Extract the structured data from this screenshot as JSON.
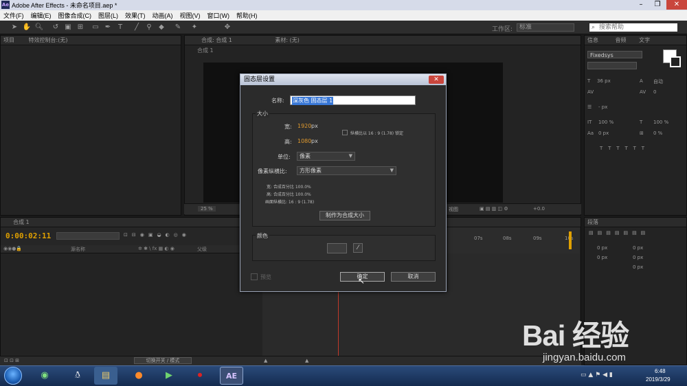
{
  "window": {
    "title": "Adobe After Effects - 未命名项目.aep *",
    "logo": "Ae"
  },
  "menu": [
    "文件(F)",
    "编辑(E)",
    "图像合成(C)",
    "图层(L)",
    "效果(T)",
    "动画(A)",
    "视图(V)",
    "窗口(W)",
    "帮助(H)"
  ],
  "toolbar": {
    "workspace_label": "工作区:",
    "workspace_value": "标准",
    "search_placeholder": "搜索帮助"
  },
  "left_panel": {
    "tab_project": "项目",
    "tab_effects": "特效控制台:(无)"
  },
  "comp_panel": {
    "tab_comp": "合成: 合成 1",
    "tab_footage": "素材: (无)",
    "comp_name": "合成 1",
    "zoom": "25 %",
    "view_label": "视图",
    "exposure": "+0.0"
  },
  "right_panel": {
    "tab_info": "信息",
    "tab_audio": "音频",
    "tab_text": "文字",
    "font_family": "Fixedsys",
    "font_size": "36 px",
    "leading": "自动",
    "tracking": "0",
    "stroke": "- px",
    "vscale": "100 %",
    "hscale": "100 %",
    "baseline": "0 px",
    "tsume": "0 %"
  },
  "right_panel2": {
    "tab": "段落",
    "indent1": "0 px",
    "indent2": "0 px",
    "indent3": "0 px",
    "space1": "0 px",
    "space2": "0 px"
  },
  "timeline": {
    "tab": "合成 1",
    "timecode": "0:00:02:11",
    "col_name": "源名称",
    "col_parent": "父级",
    "ruler_labels": [
      "07s",
      "08s",
      "09s",
      "10s"
    ],
    "switches_label": "切换开关 / 模式"
  },
  "dialog": {
    "title": "固态层设置",
    "name_label": "名称:",
    "name_value": "深灰色 固态层 1",
    "size_group": "大小",
    "width_label": "宽:",
    "width_value": "1920",
    "height_label": "高:",
    "height_value": "1080",
    "px_unit": "px",
    "lock_label": "纵横比以 16 : 9 (1.78) 锁定",
    "units_label": "单位:",
    "units_value": "像素",
    "par_label": "像素纵横比:",
    "par_value": "方形像素",
    "info_width": "宽: 合成百分比 100.0%",
    "info_height": "高: 合成百分比 100.0%",
    "info_frame": "画面纵横比: 16 : 9 (1.78)",
    "make_comp_size": "制作为合成大小",
    "color_group": "颜色",
    "preview_label": "预览",
    "ok": "确定",
    "cancel": "取消"
  },
  "taskbar": {
    "time": "6:48",
    "date": "2019/3/29",
    "ae_label": "AE"
  },
  "watermark": {
    "logo": "Bai 经验",
    "url": "jingyan.baidu.com"
  }
}
